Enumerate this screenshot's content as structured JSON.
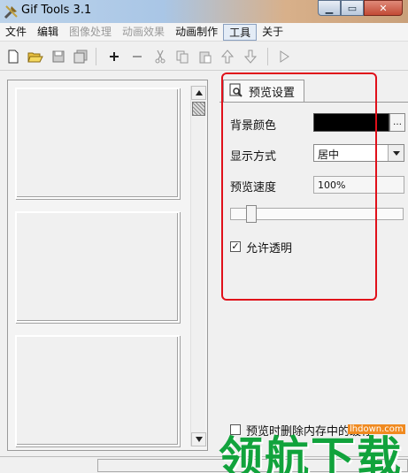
{
  "window": {
    "title": "Gif Tools 3.1",
    "controls": [
      "minimize-icon",
      "maximize-icon",
      "close-icon"
    ]
  },
  "menu": {
    "items": [
      {
        "label": "文件",
        "enabled": true
      },
      {
        "label": "编辑",
        "enabled": true
      },
      {
        "label": "图像处理",
        "enabled": false
      },
      {
        "label": "动画效果",
        "enabled": false
      },
      {
        "label": "动画制作",
        "enabled": true
      },
      {
        "label": "工具",
        "enabled": true,
        "active": true
      },
      {
        "label": "关于",
        "enabled": true
      }
    ]
  },
  "toolbar": {
    "buttons": [
      "new-file-icon",
      "open-folder-icon",
      "save-icon",
      "save-all-icon",
      "add-icon",
      "remove-icon",
      "cut-icon",
      "copy-icon",
      "paste-icon",
      "move-up-icon",
      "move-down-icon",
      "play-icon"
    ]
  },
  "preview": {
    "tab_label": "预览设置",
    "bg_color_label": "背景颜色",
    "bg_color_value": "#000000",
    "bg_color_button": "…",
    "display_mode_label": "显示方式",
    "display_mode_value": "居中",
    "speed_label": "预览速度",
    "speed_value": "100%",
    "speed_level": 0.1,
    "allow_transparency_label": "允许透明",
    "allow_transparency_checked": true,
    "delete_label": "预览时删除内存中的缓存"
  },
  "watermark": {
    "text": "领航下载",
    "url": "lhdown.com"
  },
  "colors": {
    "highlight_box": "#e0101a",
    "watermark_green": "#11a33c"
  }
}
